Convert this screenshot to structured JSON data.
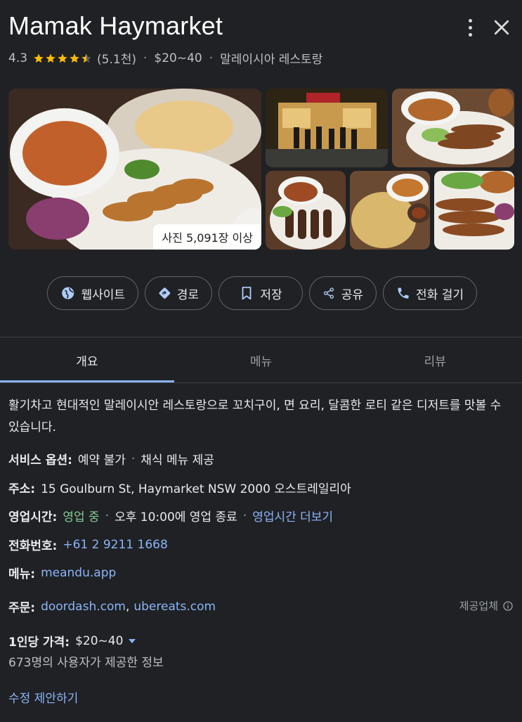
{
  "header": {
    "title": "Mamak Haymarket",
    "rating": "4.3",
    "stars_value": 4.3,
    "review_count": "(5.1천)",
    "price": "$20~40",
    "category": "말레이시아 레스토랑",
    "separator": "·",
    "more_icon": "more-vert-icon",
    "close_icon": "close-icon"
  },
  "photos": {
    "count_label": "사진 5,091장 이상"
  },
  "actions": [
    {
      "label": "웹사이트",
      "icon": "globe-icon"
    },
    {
      "label": "경로",
      "icon": "directions-icon"
    },
    {
      "label": "저장",
      "icon": "bookmark-icon"
    },
    {
      "label": "공유",
      "icon": "share-icon"
    },
    {
      "label": "전화 걸기",
      "icon": "phone-icon"
    }
  ],
  "tabs": [
    {
      "label": "개요",
      "active": true
    },
    {
      "label": "메뉴",
      "active": false
    },
    {
      "label": "리뷰",
      "active": false
    }
  ],
  "overview": {
    "description": "활기차고 현대적인 말레이시안 레스토랑으로 꼬치구이, 면 요리, 달콤한 로티 같은 디저트를 맛볼 수 있습니다.",
    "service": {
      "label": "서비스 옵션:",
      "value1": "예약 불가",
      "sep": "·",
      "value2": "채식 메뉴 제공"
    },
    "address": {
      "label": "주소:",
      "value": "15 Goulburn St, Haymarket NSW 2000 오스트레일리아"
    },
    "hours": {
      "label": "영업시간:",
      "status": "영업 중",
      "sep1": "·",
      "closing": "오후 10:00에 영업 종료",
      "sep2": "·",
      "more": "영업시간 더보기"
    },
    "phone": {
      "label": "전화번호:",
      "value": "+61 2 9211 1668"
    },
    "menu": {
      "label": "메뉴:",
      "value": "meandu.app"
    },
    "order": {
      "label": "주문:",
      "link1": "doordash.com",
      "comma": ",",
      "link2": "ubereats.com",
      "provider": "제공업체"
    },
    "price_per_person": {
      "label": "1인당 가격:",
      "value": "$20~40",
      "source": "673명의 사용자가 제공한 정보"
    },
    "suggest_edit": "수정 제안하기"
  },
  "colors": {
    "background": "#202124",
    "link": "#8ab4f8",
    "open": "#81c995",
    "star": "#fbbc04"
  }
}
